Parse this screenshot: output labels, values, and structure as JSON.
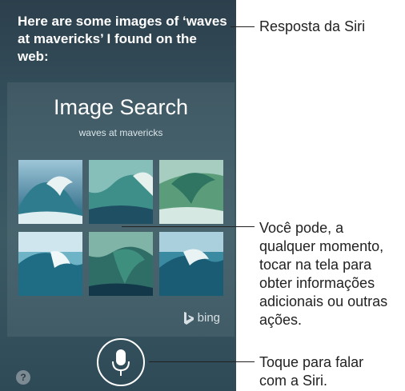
{
  "siri": {
    "response_text": "Here are some images of ‘waves at mavericks’ I found on the web:"
  },
  "card": {
    "title": "Image Search",
    "subtitle": "waves at mavericks",
    "provider": "bing"
  },
  "images": [
    {
      "label": "wave image 1"
    },
    {
      "label": "wave image 2"
    },
    {
      "label": "wave image 3"
    },
    {
      "label": "wave image 4"
    },
    {
      "label": "wave image 5"
    },
    {
      "label": "wave image 6"
    }
  ],
  "controls": {
    "help_label": "?",
    "mic_icon": "microphone-icon"
  },
  "callouts": {
    "siri_response": "Resposta da Siri",
    "tap_screen_lines": [
      "Você pode, a",
      "qualquer momento,",
      "tocar na tela para",
      "obter informações",
      "adicionais ou outras",
      "ações."
    ],
    "tap_to_speak_lines": [
      "Toque para falar",
      "com a Siri."
    ]
  },
  "colors": {
    "background": "#2c3f4c",
    "accent": "#ffffff"
  }
}
